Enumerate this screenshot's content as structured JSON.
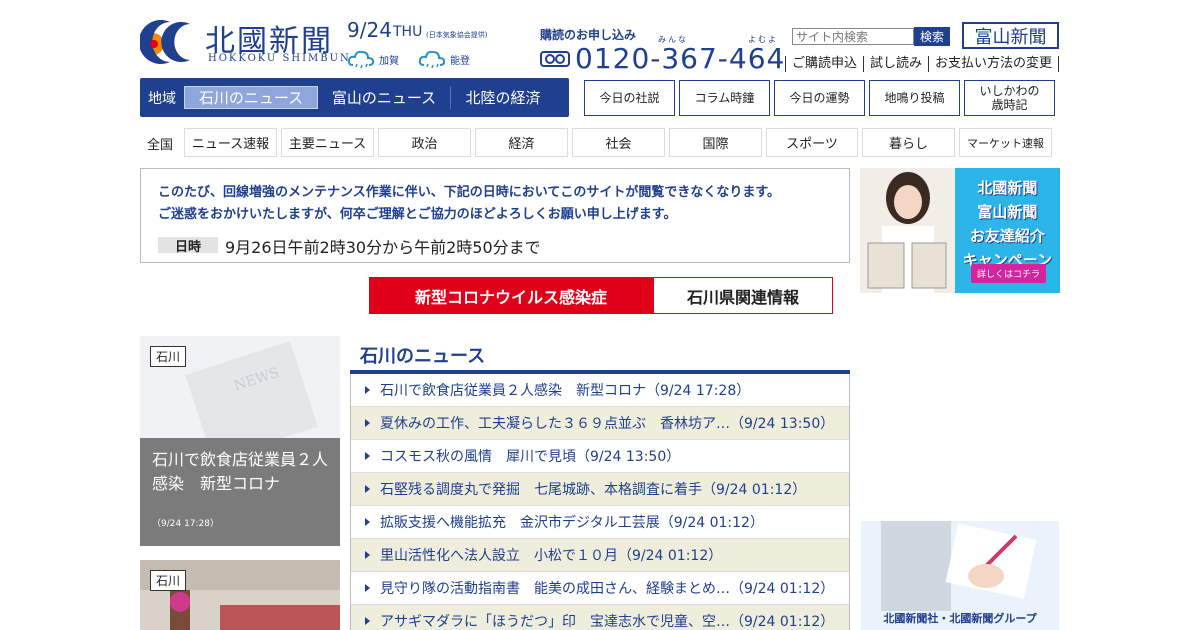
{
  "header": {
    "logo_title": "北國新聞",
    "logo_sub": "HOKKOKU SHIMBUN",
    "date": "9/24",
    "day": "THU",
    "weather_source": "(日本気象協会提供)",
    "weather": [
      {
        "area": "加賀",
        "icon": "cloud-icon"
      },
      {
        "area": "能登",
        "icon": "cloud-icon"
      }
    ],
    "subscribe_title": "購読のお申し込み",
    "phone_ruby": [
      "みんな",
      "よむよ"
    ],
    "phone": "0120-367-464",
    "search_placeholder": "サイト内検索",
    "search_button": "検索",
    "toyama_button": "富山新聞",
    "links": [
      "ご購読申込",
      "試し読み",
      "お支払い方法の変更"
    ]
  },
  "region_nav": {
    "label": "地域",
    "tabs": [
      "石川のニュース",
      "富山のニュース",
      "北陸の経済"
    ],
    "active": 0
  },
  "box_buttons": [
    "今日の社説",
    "コラム時鐘",
    "今日の運勢",
    "地鳴り投稿",
    "いしかわの\n歳時記"
  ],
  "categories": {
    "label": "全国",
    "items": [
      "ニュース速報",
      "主要ニュース",
      "政治",
      "経済",
      "社会",
      "国際",
      "スポーツ",
      "暮らし",
      "マーケット速報"
    ]
  },
  "notice": {
    "line1": "このたび、回線増強のメンテナンス作業に伴い、下記の日時においてこのサイトが閲覧できなくなります。",
    "line2": "ご迷惑をおかけいたしますが、何卒ご理解とご協力のほどよろしくお願い申し上げます。",
    "key": "日時",
    "value": "9月26日午前2時30分から午前2時50分まで"
  },
  "covid_banner": {
    "left": "新型コロナウイルス感染症",
    "right": "石川県関連情報"
  },
  "ads": {
    "campaign_lines": [
      "北國新聞",
      "富山新聞",
      "お友達紹介",
      "キャンペーン"
    ],
    "campaign_cta": "詳しくはコチラ",
    "group_text": "北國新聞社・北國新聞グループ"
  },
  "features": [
    {
      "tag": "石川",
      "title": "石川で飲食店従業員２人感染　新型コロナ",
      "date": "（9/24 17:28）"
    },
    {
      "tag": "石川"
    }
  ],
  "news": {
    "title": "石川のニュース",
    "items": [
      "石川で飲食店従業員２人感染　新型コロナ（9/24 17:28）",
      "夏休みの工作、工夫凝らした３６９点並ぶ　香林坊ア…（9/24 13:50）",
      "コスモス秋の風情　犀川で見頃（9/24 13:50）",
      "石堅残る調度丸で発掘　七尾城跡、本格調査に着手（9/24 01:12）",
      "拡販支援へ機能拡充　金沢市デジタル工芸展（9/24 01:12）",
      "里山活性化へ法人設立　小松で１０月（9/24 01:12）",
      "見守り隊の活動指南書　能美の成田さん、経験まとめ…（9/24 01:12）",
      "アサギマダラに「ほうだつ」印　宝達志水で児童、空…（9/24 01:12）"
    ]
  },
  "colors": {
    "brand": "#1f3f8f",
    "red": "#e0001a",
    "row_alt": "#efeedd"
  }
}
